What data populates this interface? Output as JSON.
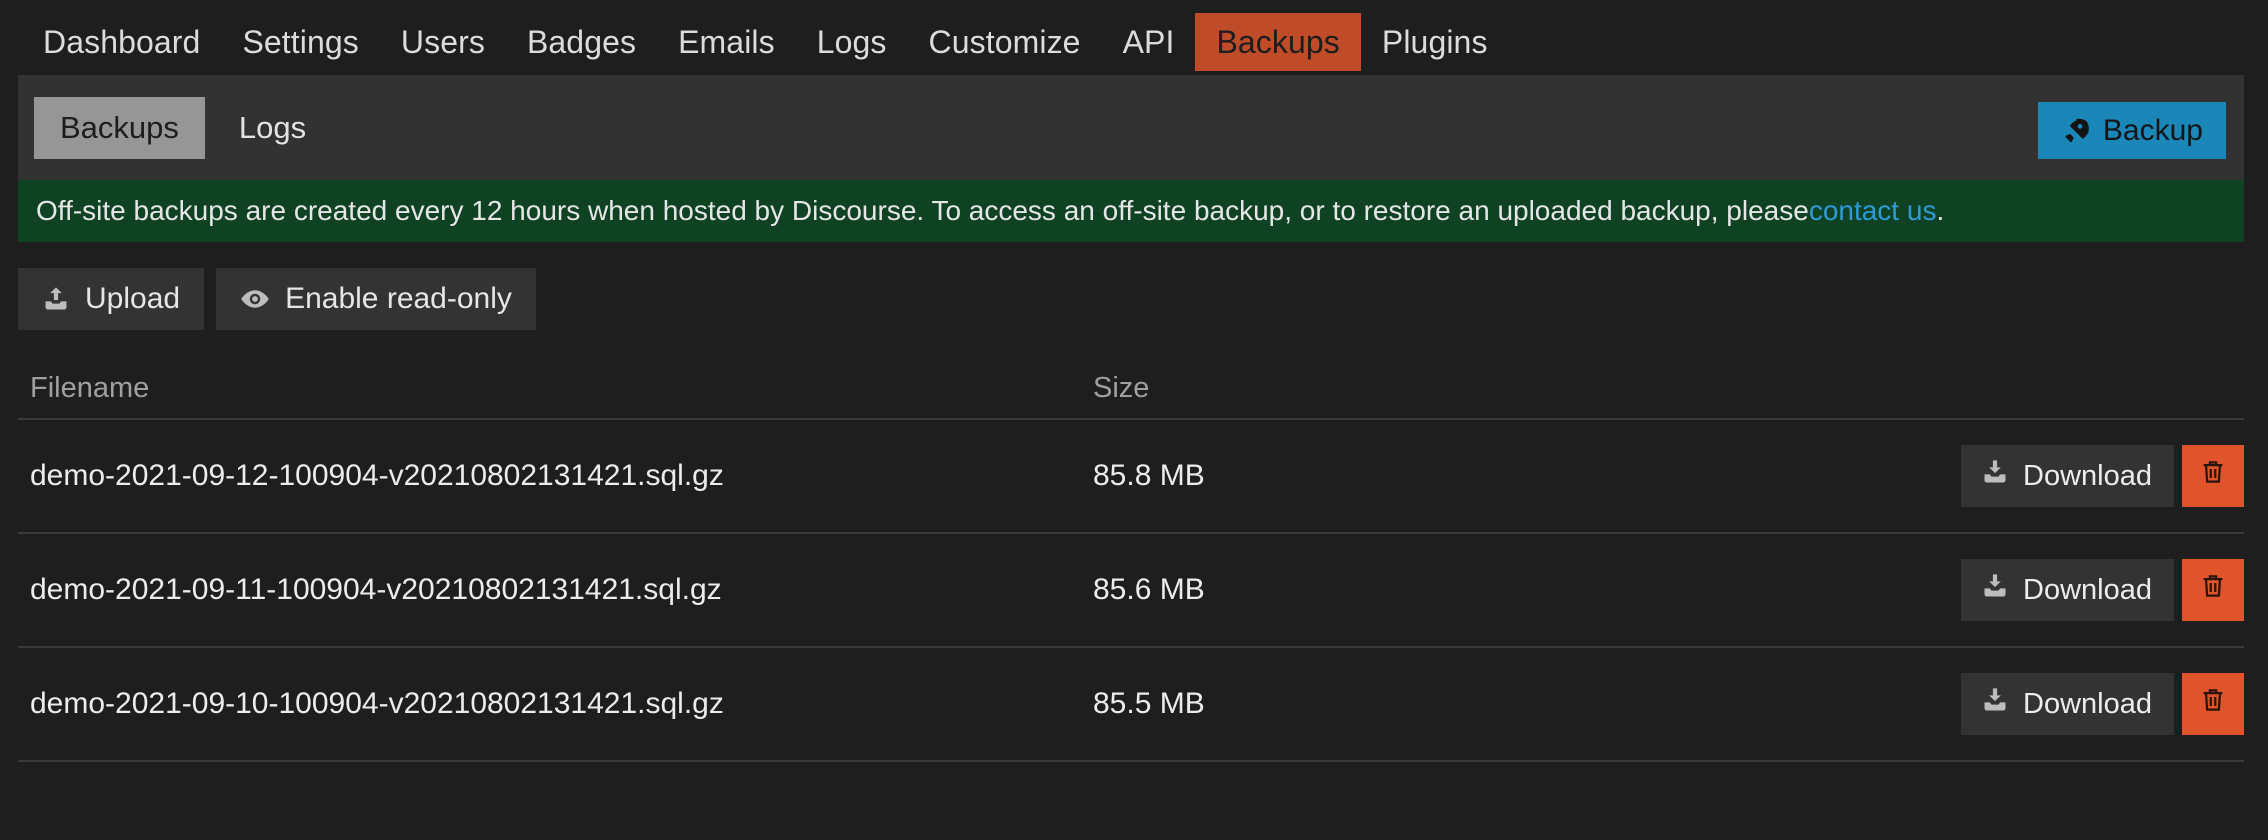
{
  "topnav": {
    "items": [
      {
        "label": "Dashboard",
        "active": false
      },
      {
        "label": "Settings",
        "active": false
      },
      {
        "label": "Users",
        "active": false
      },
      {
        "label": "Badges",
        "active": false
      },
      {
        "label": "Emails",
        "active": false
      },
      {
        "label": "Logs",
        "active": false
      },
      {
        "label": "Customize",
        "active": false
      },
      {
        "label": "API",
        "active": false
      },
      {
        "label": "Backups",
        "active": true
      },
      {
        "label": "Plugins",
        "active": false
      }
    ]
  },
  "subbar": {
    "tabs": [
      {
        "label": "Backups",
        "active": true
      },
      {
        "label": "Logs",
        "active": false
      }
    ],
    "backup_button": {
      "label": "Backup",
      "icon": "rocket-icon",
      "color": "#1b87b8"
    }
  },
  "notice": {
    "text_before_link": "Off-site backups are created every 12 hours when hosted by Discourse. To access an off-site backup, or to restore an uploaded backup, please ",
    "link_text": "contact us",
    "text_after_link": ".",
    "background": "#0e4223",
    "link_color": "#2e9bd6"
  },
  "actions": {
    "upload": {
      "label": "Upload",
      "icon": "upload-icon"
    },
    "read_only": {
      "label": "Enable read-only",
      "icon": "eye-icon"
    }
  },
  "table": {
    "headers": {
      "filename": "Filename",
      "size": "Size"
    },
    "row_actions": {
      "download_label": "Download",
      "download_icon": "download-icon",
      "delete_icon": "trash-icon",
      "delete_color": "#e0542b"
    },
    "rows": [
      {
        "filename": "demo-2021-09-12-100904-v20210802131421.sql.gz",
        "size": "85.8 MB"
      },
      {
        "filename": "demo-2021-09-11-100904-v20210802131421.sql.gz",
        "size": "85.6 MB"
      },
      {
        "filename": "demo-2021-09-10-100904-v20210802131421.sql.gz",
        "size": "85.5 MB"
      }
    ]
  },
  "colors": {
    "page_background": "#1e1e1e",
    "panel_background": "#323232",
    "active_nav": "#c04b28",
    "active_subtab": "#969696"
  }
}
